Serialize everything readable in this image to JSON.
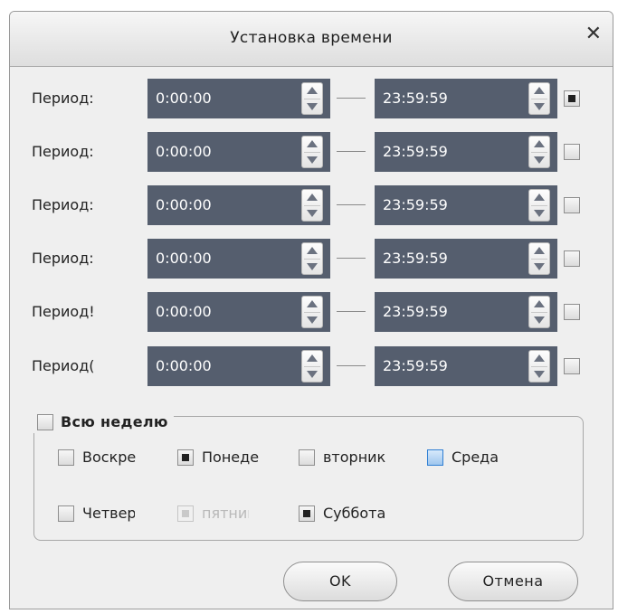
{
  "dialog": {
    "title": "Установка времени",
    "close_glyph": "✕"
  },
  "periods": [
    {
      "label": "Период:",
      "start": "0:00:00",
      "end": "23:59:59",
      "enabled": true
    },
    {
      "label": "Период:",
      "start": "0:00:00",
      "end": "23:59:59",
      "enabled": false
    },
    {
      "label": "Период:",
      "start": "0:00:00",
      "end": "23:59:59",
      "enabled": false
    },
    {
      "label": "Период:",
      "start": "0:00:00",
      "end": "23:59:59",
      "enabled": false
    },
    {
      "label": "Период!",
      "start": "0:00:00",
      "end": "23:59:59",
      "enabled": false
    },
    {
      "label": "Период(",
      "start": "0:00:00",
      "end": "23:59:59",
      "enabled": false
    }
  ],
  "week": {
    "label": "Всю неделю",
    "checked": false,
    "days": [
      {
        "label": "Воскре",
        "checked": false,
        "disabled": false,
        "focused": false
      },
      {
        "label": "Понеде",
        "checked": true,
        "disabled": false,
        "focused": false
      },
      {
        "label": "вторник",
        "checked": false,
        "disabled": false,
        "focused": false
      },
      {
        "label": "Среда",
        "checked": false,
        "disabled": false,
        "focused": true
      },
      {
        "label": "Четверг",
        "checked": false,
        "disabled": false,
        "focused": false
      },
      {
        "label": "пятниц:",
        "checked": true,
        "disabled": true,
        "focused": false
      },
      {
        "label": "Суббота",
        "checked": true,
        "disabled": false,
        "focused": false
      }
    ]
  },
  "buttons": {
    "ok": "OK",
    "cancel": "Отмена"
  },
  "colors": {
    "time_field_bg": "#555e6e",
    "dialog_bg": "#efefef",
    "focus_accent": "#2f7fd3"
  },
  "icons": {
    "spinner": "spinner-up-down-icon",
    "close": "close-icon"
  }
}
